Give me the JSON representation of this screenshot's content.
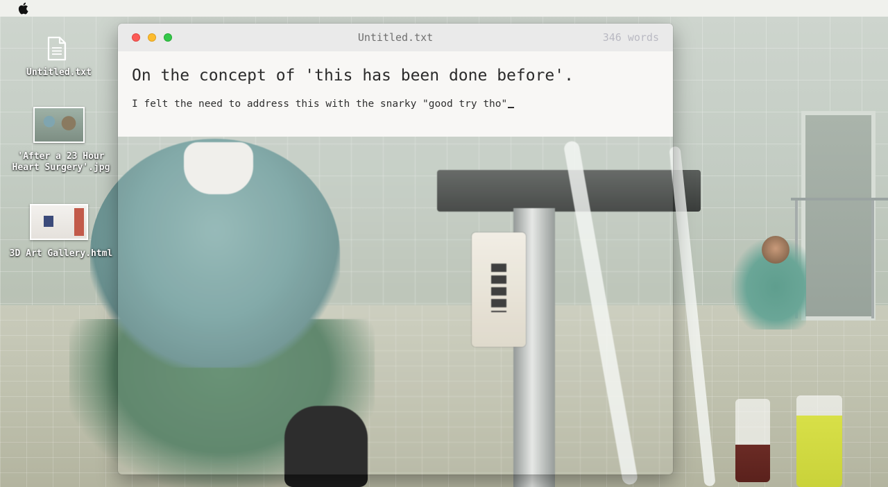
{
  "menubar": {
    "apple_icon": "apple-logo-icon"
  },
  "desktop": {
    "icons": [
      {
        "label": "Untitled.txt",
        "icon": "text-document-icon"
      },
      {
        "label": "'After a 23 Hour\nHeart Surgery'.jpg",
        "icon": "image-thumbnail-icon"
      },
      {
        "label": "3D Art Gallery.html",
        "icon": "html-thumbnail-icon"
      }
    ]
  },
  "window": {
    "title": "Untitled.txt",
    "word_count": "346 words",
    "controls": {
      "close_color": "#fc5b57",
      "minimize_color": "#fdbc2e",
      "zoom_color": "#34c84a"
    },
    "document": {
      "heading": "On the concept of 'this has been done before'.",
      "line": "I felt the need to address this with the snarky \"good try tho\""
    }
  }
}
